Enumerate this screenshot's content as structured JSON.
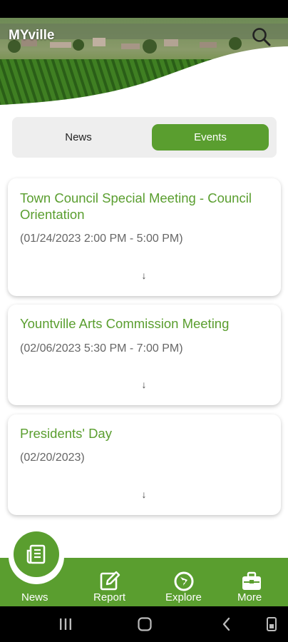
{
  "app": {
    "title": "MYville"
  },
  "tabs": {
    "news_label": "News",
    "events_label": "Events",
    "active": "Events"
  },
  "events": [
    {
      "title": "Town Council Special Meeting - Council Orientation",
      "date": "(01/24/2023 2:00 PM - 5:00 PM)"
    },
    {
      "title": "Yountville Arts Commission Meeting",
      "date": "(02/06/2023 5:30 PM - 7:00 PM)"
    },
    {
      "title": "Presidents' Day",
      "date": "(02/20/2023)"
    }
  ],
  "bottom_nav": {
    "items": [
      {
        "label": "News",
        "icon": "newspaper-icon",
        "active": true
      },
      {
        "label": "Report",
        "icon": "edit-icon"
      },
      {
        "label": "Explore",
        "icon": "compass-icon"
      },
      {
        "label": "More",
        "icon": "briefcase-icon"
      }
    ]
  },
  "colors": {
    "accent": "#5a9e2f",
    "segment_bg": "#eeeeee",
    "date_text": "#666666"
  }
}
